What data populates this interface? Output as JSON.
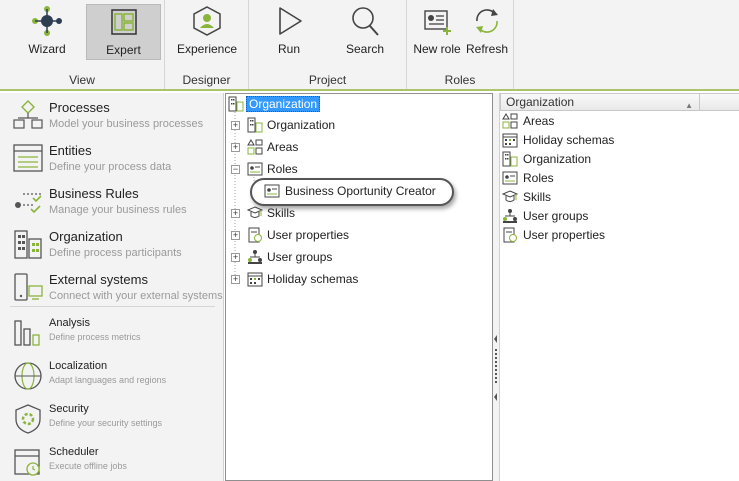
{
  "ribbon": {
    "groups": {
      "view": "View",
      "designer": "Designer",
      "project": "Project",
      "roles": "Roles"
    },
    "buttons": {
      "wizard": "Wizard",
      "expert": "Expert",
      "experience": "Experience",
      "run": "Run",
      "search": "Search",
      "new_role": "New role",
      "refresh": "Refresh"
    },
    "active_button": "Expert"
  },
  "nav": {
    "items": [
      {
        "title": "Processes",
        "subtitle": "Model your business processes",
        "icon": "processes-icon"
      },
      {
        "title": "Entities",
        "subtitle": "Define your process data",
        "icon": "entities-icon"
      },
      {
        "title": "Business Rules",
        "subtitle": "Manage your business rules",
        "icon": "business-rules-icon"
      },
      {
        "title": "Organization",
        "subtitle": "Define process participants",
        "icon": "organization-icon"
      },
      {
        "title": "External systems",
        "subtitle": "Connect with your external systems",
        "icon": "external-systems-icon"
      },
      {
        "title": "Analysis",
        "subtitle": "Define process metrics",
        "icon": "analysis-icon"
      },
      {
        "title": "Localization",
        "subtitle": "Adapt languages and regions",
        "icon": "globe-icon"
      },
      {
        "title": "Security",
        "subtitle": "Define your security settings",
        "icon": "security-icon"
      },
      {
        "title": "Scheduler",
        "subtitle": "Execute offline jobs",
        "icon": "calendar-icon"
      }
    ]
  },
  "tree": {
    "root": "Organization",
    "nodes": [
      {
        "label": "Organization",
        "expander": "+"
      },
      {
        "label": "Areas",
        "expander": "+"
      },
      {
        "label": "Roles",
        "expander": "−"
      },
      {
        "label": "Skills",
        "expander": "+"
      },
      {
        "label": "User properties",
        "expander": "+"
      },
      {
        "label": "User groups",
        "expander": "+"
      },
      {
        "label": "Holiday schemas",
        "expander": "+"
      }
    ],
    "child": "Business Oportunity Creator"
  },
  "list": {
    "header": "Organization",
    "items": [
      "Areas",
      "Holiday schemas",
      "Organization",
      "Roles",
      "Skills",
      "User groups",
      "User properties"
    ]
  },
  "colors": {
    "accent_green": "#a9c46b",
    "selection_blue": "#3399ff",
    "ribbon_bg": "#f3f3f3"
  }
}
